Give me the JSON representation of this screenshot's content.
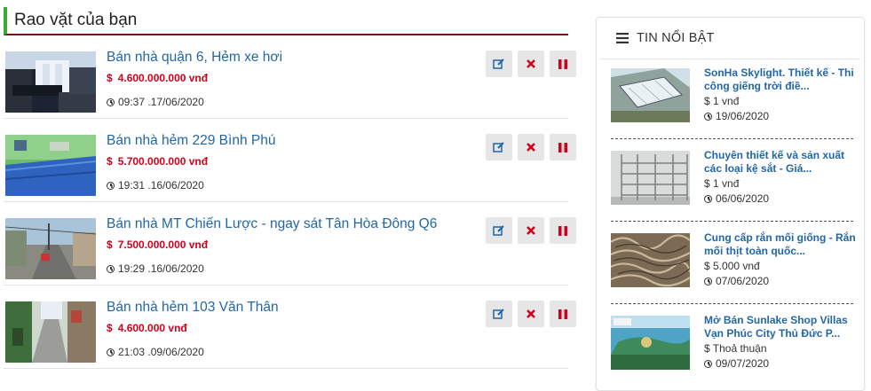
{
  "left": {
    "title": "Rao vặt của bạn",
    "listings": [
      {
        "title": "Bán nhà quận 6, Hẻm xe hơi",
        "currency": "$",
        "price": "4.600.000.000 vnđ",
        "date": "09:37 .17/06/2020"
      },
      {
        "title": "Bán nhà hẻm 229 Bình Phú",
        "currency": "$",
        "price": "5.700.000.000 vnđ",
        "date": "19:31 .16/06/2020"
      },
      {
        "title": "Bán nhà MT Chiến Lược - ngay sát Tân Hòa Đông Q6",
        "currency": "$",
        "price": "7.500.000.000 vnđ",
        "date": "19:29 .16/06/2020"
      },
      {
        "title": "Bán nhà hẻm 103 Văn Thân",
        "currency": "$",
        "price": "4.600.000 vnđ",
        "date": "21:03 .09/06/2020"
      }
    ]
  },
  "right": {
    "title": "TIN NỔI BẬT",
    "items": [
      {
        "title": "SonHa Skylight. Thiết kế - Thi công giếng trời điề...",
        "price": "$ 1 vnđ",
        "date": "19/06/2020"
      },
      {
        "title": "Chuyên thiết kế và sản xuất các loại kệ sắt - Giá...",
        "price": "$ 1 vnđ",
        "date": "06/06/2020"
      },
      {
        "title": "Cung cấp rắn mối giống - Rắn mối thịt toàn quốc...",
        "price": "$ 5.000 vnđ",
        "date": "07/06/2020"
      },
      {
        "title": "Mở Bán Sunlake Shop Villas Vạn Phúc City Thủ Đức P...",
        "price": "$ Thoả thuận",
        "date": "09/07/2020"
      }
    ]
  },
  "icons": {
    "edit": "edit-icon",
    "delete": "delete-icon",
    "pause": "pause-icon",
    "clock": "clock-icon",
    "menu": "menu-icon"
  },
  "colors": {
    "accent_green": "#3aaa35",
    "header_line": "#7a1313",
    "link_blue": "#2167a8",
    "price_red": "#d0021b"
  }
}
